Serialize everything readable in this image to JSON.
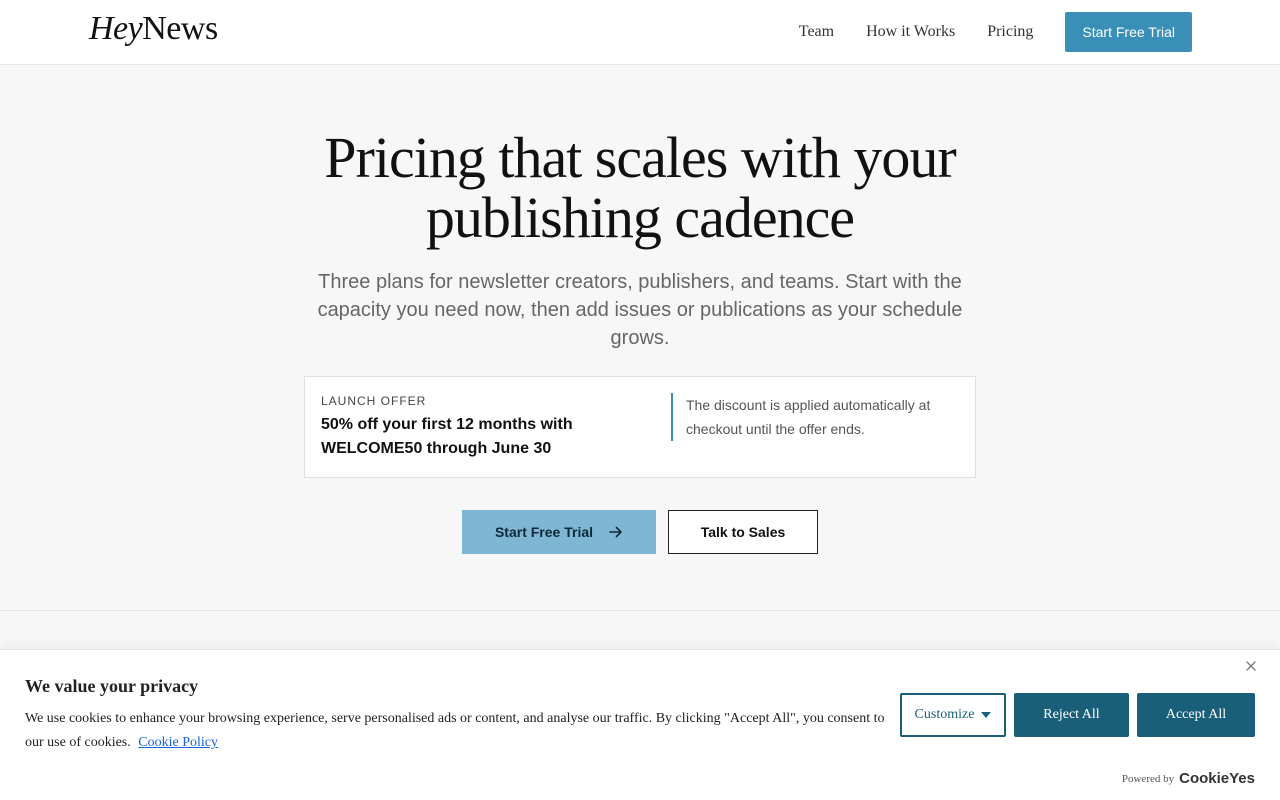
{
  "header": {
    "logo_part1": "Hey",
    "logo_part2": "News",
    "nav": [
      "Team",
      "How it Works",
      "Pricing"
    ],
    "cta": "Start Free Trial"
  },
  "hero": {
    "title_line1": "Pricing that scales with your",
    "title_line2": "publishing cadence",
    "subtitle": "Three plans for newsletter creators, publishers, and teams. Start with the capacity you need now, then add issues or publications as your schedule grows."
  },
  "offer": {
    "label": "LAUNCH OFFER",
    "main": "50% off your first 12 months with WELCOME50 through June 30",
    "note": "The discount is applied automatically at checkout until the offer ends."
  },
  "actions": {
    "trial": "Start Free Trial",
    "sales": "Talk to Sales"
  },
  "cookie": {
    "title": "We value your privacy",
    "text": "We use cookies to enhance your browsing experience, serve personalised ads or content, and analyse our traffic. By clicking \"Accept All\", you consent to our use of cookies.",
    "policy_link": "Cookie Policy",
    "customize": "Customize",
    "reject": "Reject All",
    "accept": "Accept All",
    "powered_by": "Powered by",
    "brand": "CookieYes"
  },
  "colors": {
    "accent": "#3a8fb7",
    "cookie_primary": "#1a5f7a"
  }
}
